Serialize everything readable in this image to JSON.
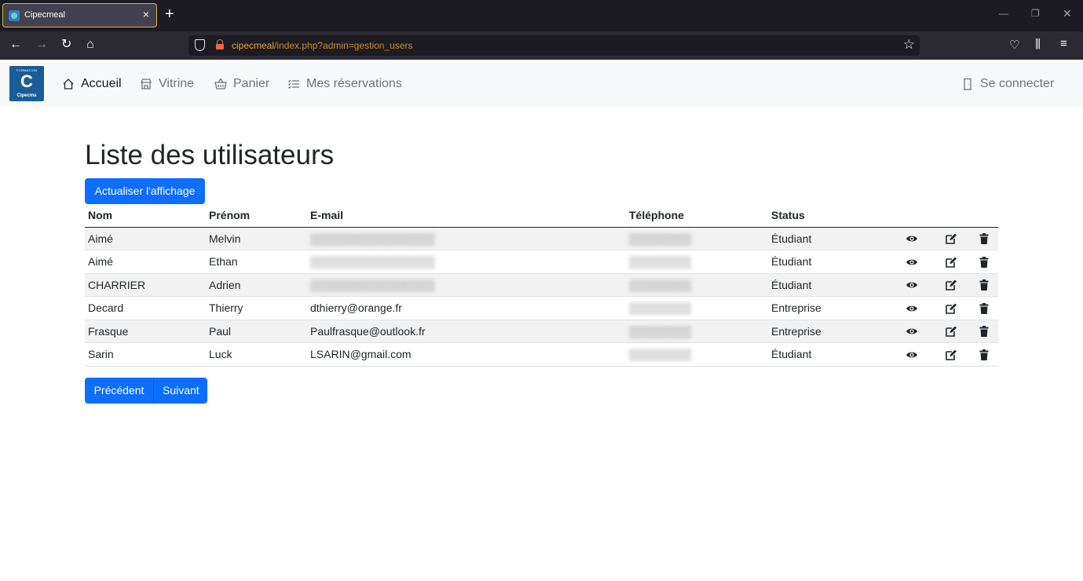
{
  "browser": {
    "tab_title": "Cipecmeal",
    "tab_close": "×",
    "new_tab": "+",
    "url_host": "cipecmeal",
    "url_path": "/index.php?admin=gestion_users"
  },
  "site": {
    "logo_top": "FORMATION",
    "logo_letter": "C",
    "logo_bottom": "Cipecma",
    "nav": {
      "home": "Accueil",
      "vitrine": "Vitrine",
      "panier": "Panier",
      "reservations": "Mes réservations",
      "login": "Se connecter"
    }
  },
  "page": {
    "title": "Liste des utilisateurs",
    "refresh_button": "Actualiser l'affichage",
    "prev_button": "Précédent",
    "next_button": "Suivant"
  },
  "table": {
    "headers": [
      "Nom",
      "Prénom",
      "E-mail",
      "Téléphone",
      "Status"
    ],
    "rows": [
      {
        "nom": "Aimé",
        "prenom": "Melvin",
        "email": "",
        "telephone": "",
        "status": "Étudiant"
      },
      {
        "nom": "Aimé",
        "prenom": "Ethan",
        "email": "",
        "telephone": "",
        "status": "Étudiant"
      },
      {
        "nom": "CHARRIER",
        "prenom": "Adrien",
        "email": "",
        "telephone": "",
        "status": "Étudiant"
      },
      {
        "nom": "Decard",
        "prenom": "Thierry",
        "email": "dthierry@orange.fr",
        "telephone": "",
        "status": "Entreprise"
      },
      {
        "nom": "Frasque",
        "prenom": "Paul",
        "email": "Paulfrasque@outlook.fr",
        "telephone": "",
        "status": "Entreprise"
      },
      {
        "nom": "Sarin",
        "prenom": "Luck",
        "email": "LSARIN@gmail.com",
        "telephone": "",
        "status": "Étudiant"
      }
    ]
  },
  "icons": {
    "view": "eye-icon",
    "edit": "edit-icon",
    "delete": "trash-icon"
  },
  "colors": {
    "primary": "#0d6efd",
    "logo": "#1a5d96",
    "striped_row": "#f2f2f2"
  }
}
